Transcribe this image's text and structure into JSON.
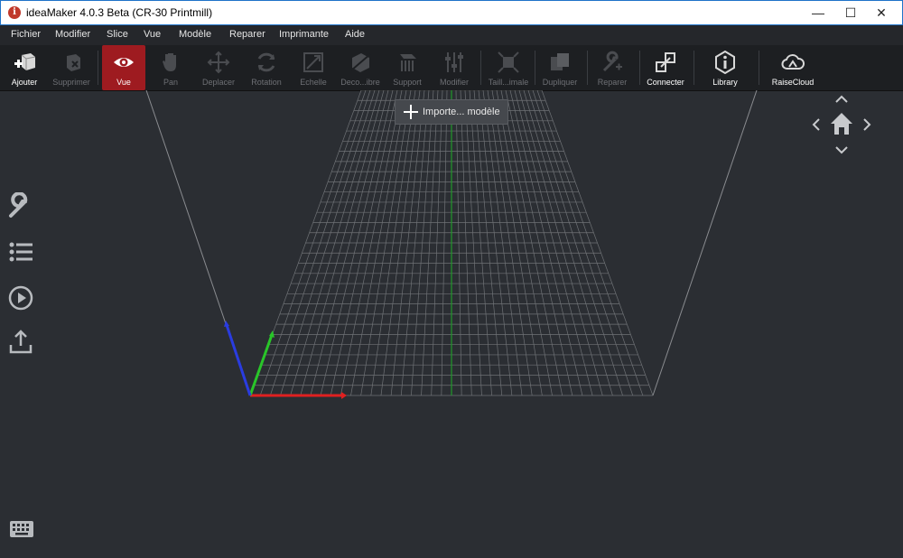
{
  "window": {
    "title": "ideaMaker 4.0.3 Beta (CR-30 Printmill)",
    "app_icon_letter": "i",
    "minimize": "—",
    "maximize": "☐",
    "close": "✕"
  },
  "menu": [
    "Fichier",
    "Modifier",
    "Slice",
    "Vue",
    "Modèle",
    "Reparer",
    "Imprimante",
    "Aide"
  ],
  "toolbar": {
    "tools": [
      {
        "label": "Ajouter",
        "icon": "add-cube-icon",
        "enabled": true
      },
      {
        "label": "Supprimer",
        "icon": "delete-cube-icon",
        "enabled": false
      },
      {
        "label": "Vue",
        "icon": "eye-icon",
        "enabled": true,
        "active": true
      },
      {
        "label": "Pan",
        "icon": "hand-icon",
        "enabled": false
      },
      {
        "label": "Deplacer",
        "icon": "move-arrows-icon",
        "enabled": false
      },
      {
        "label": "Rotation",
        "icon": "rotate-icon",
        "enabled": false
      },
      {
        "label": "Echelle",
        "icon": "scale-icon",
        "enabled": false
      },
      {
        "label": "Deco...ibre",
        "icon": "cut-icon",
        "enabled": false
      },
      {
        "label": "Support",
        "icon": "support-icon",
        "enabled": false
      },
      {
        "label": "Modifier",
        "icon": "sliders-icon",
        "enabled": false
      },
      {
        "label": "Taill...imale",
        "icon": "max-size-icon",
        "enabled": false
      },
      {
        "label": "Dupliquer",
        "icon": "duplicate-icon",
        "enabled": false
      },
      {
        "label": "Reparer",
        "icon": "wrench-plus-icon",
        "enabled": false
      },
      {
        "label": "Connecter",
        "icon": "connect-icon",
        "enabled": true
      },
      {
        "label": "Library",
        "icon": "info-hexagon-icon",
        "enabled": true
      },
      {
        "label": "RaiseCloud",
        "icon": "cloud-icon",
        "enabled": true
      }
    ]
  },
  "viewport": {
    "import_button": "Importe... modèle",
    "sidebar_icons": [
      "wrench-icon",
      "list-icon",
      "play-icon",
      "export-icon"
    ],
    "nav_cube": "home-icon",
    "keyboard": "keyboard-icon"
  },
  "colors": {
    "accent": "#9e1b20",
    "axis_x": "#e02020",
    "axis_y": "#29c529",
    "axis_z": "#2a3ce0"
  }
}
